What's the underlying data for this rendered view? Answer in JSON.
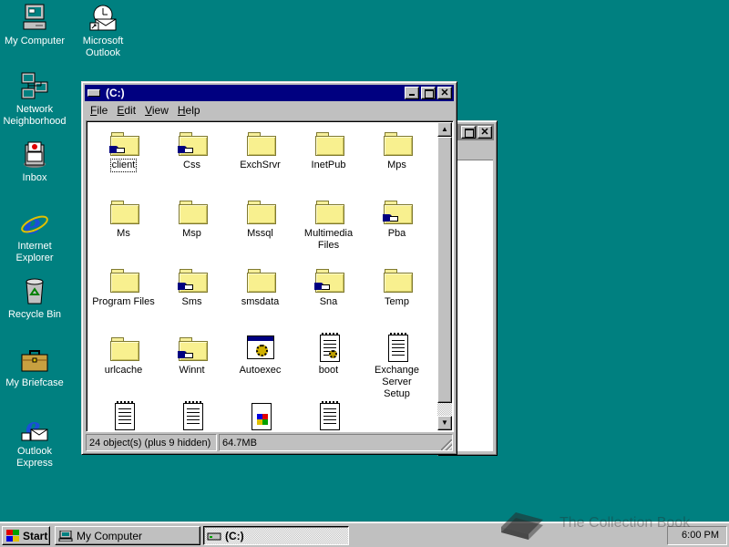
{
  "desktop": {
    "icons": [
      {
        "label": "My Computer"
      },
      {
        "label": "Microsoft Outlook"
      },
      {
        "label": "Network Neighborhood"
      },
      {
        "label": "Inbox"
      },
      {
        "label": "Internet Explorer"
      },
      {
        "label": "Recycle Bin"
      },
      {
        "label": "My Briefcase"
      },
      {
        "label": "Outlook Express"
      }
    ]
  },
  "window": {
    "title": "(C:)",
    "menu": [
      "File",
      "Edit",
      "View",
      "Help"
    ],
    "items": [
      {
        "label": "client",
        "icon": "shared-folder-icon"
      },
      {
        "label": "Css",
        "icon": "shared-folder-icon"
      },
      {
        "label": "ExchSrvr",
        "icon": "folder-icon"
      },
      {
        "label": "InetPub",
        "icon": "folder-icon"
      },
      {
        "label": "Mps",
        "icon": "folder-icon"
      },
      {
        "label": "Ms",
        "icon": "folder-icon"
      },
      {
        "label": "Msp",
        "icon": "folder-icon"
      },
      {
        "label": "Mssql",
        "icon": "folder-icon"
      },
      {
        "label": "Multimedia Files",
        "icon": "folder-icon"
      },
      {
        "label": "Pba",
        "icon": "shared-folder-icon"
      },
      {
        "label": "Program Files",
        "icon": "folder-icon"
      },
      {
        "label": "Sms",
        "icon": "shared-folder-icon"
      },
      {
        "label": "smsdata",
        "icon": "folder-icon"
      },
      {
        "label": "Sna",
        "icon": "shared-folder-icon"
      },
      {
        "label": "Temp",
        "icon": "folder-icon"
      },
      {
        "label": "urlcache",
        "icon": "folder-icon"
      },
      {
        "label": "Winnt",
        "icon": "shared-folder-icon"
      },
      {
        "label": "Autoexec",
        "icon": "batch-file-icon"
      },
      {
        "label": "boot",
        "icon": "config-file-icon"
      },
      {
        "label": "Exchange Server Setup",
        "icon": "text-document-icon"
      },
      {
        "label": "",
        "icon": "text-document-icon"
      },
      {
        "label": "",
        "icon": "text-document-icon"
      },
      {
        "label": "",
        "icon": "windows-document-icon"
      },
      {
        "label": "",
        "icon": "text-document-icon"
      }
    ],
    "status": {
      "objects": "24 object(s) (plus 9 hidden)",
      "size": "64.7MB"
    }
  },
  "taskbar": {
    "start_label": "Start",
    "tasks": [
      {
        "label": "My Computer",
        "pressed": false
      },
      {
        "label": "(C:)",
        "pressed": true
      }
    ],
    "clock": "6:00 PM"
  },
  "watermark": {
    "text": "The Collection Book"
  },
  "colors": {
    "desktop": "#008080",
    "title_active": "#000080",
    "title_inactive": "#808080",
    "face": "#c0c0c0"
  }
}
